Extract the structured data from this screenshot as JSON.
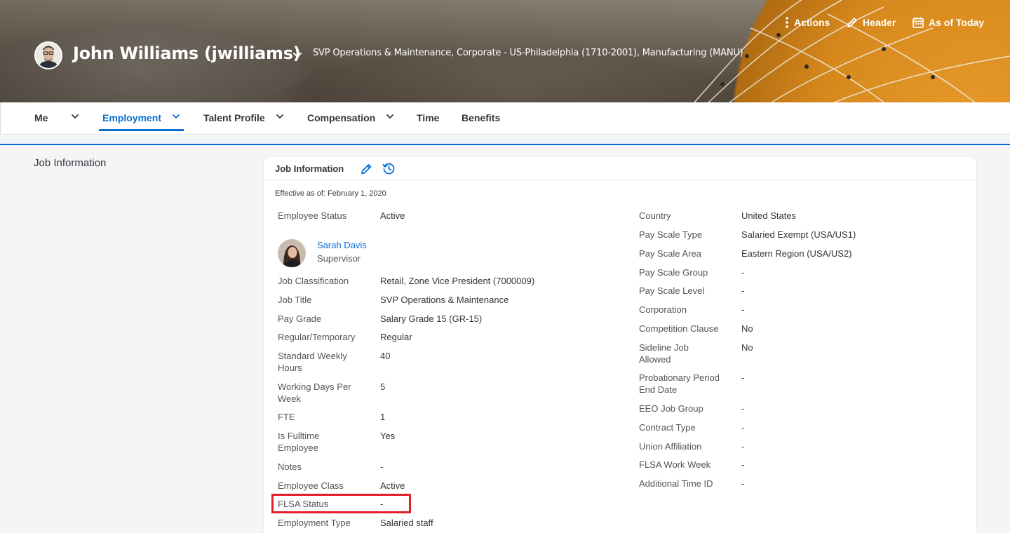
{
  "header": {
    "name": "John Williams (jwilliams)",
    "subtitle": "SVP Operations & Maintenance, Corporate - US-Philadelphia (1710-2001), Manufacturing (MANU)",
    "actions_label": "Actions",
    "header_label": "Header",
    "as_of_label": "As of Today"
  },
  "tabs": [
    {
      "label": "Me"
    },
    {
      "label": "Employment"
    },
    {
      "label": "Talent Profile"
    },
    {
      "label": "Compensation"
    },
    {
      "label": "Time"
    },
    {
      "label": "Benefits"
    }
  ],
  "sidebar": {
    "item": "Job Information"
  },
  "card": {
    "title": "Job Information",
    "effective": "Effective as of: February 1, 2020",
    "supervisor": {
      "name": "Sarah Davis",
      "role": "Supervisor"
    },
    "left_fields": [
      {
        "label": "Employee Status",
        "value": "Active"
      },
      {
        "label": "Job Classification",
        "value": "Retail, Zone Vice President (7000009)"
      },
      {
        "label": "Job Title",
        "value": "SVP Operations & Maintenance"
      },
      {
        "label": "Pay Grade",
        "value": "Salary Grade 15 (GR-15)"
      },
      {
        "label": "Regular/Temporary",
        "value": "Regular"
      },
      {
        "label": "Standard Weekly Hours",
        "value": "40"
      },
      {
        "label": "Working Days Per Week",
        "value": "5"
      },
      {
        "label": "FTE",
        "value": "1"
      },
      {
        "label": "Is Fulltime Employee",
        "value": "Yes"
      },
      {
        "label": "Notes",
        "value": "-"
      },
      {
        "label": "Employee Class",
        "value": "Active"
      },
      {
        "label": "FLSA Status",
        "value": "-"
      },
      {
        "label": "Employment Type",
        "value": "Salaried staff"
      }
    ],
    "right_fields": [
      {
        "label": "Country",
        "value": "United States"
      },
      {
        "label": "Pay Scale Type",
        "value": "Salaried Exempt (USA/US1)"
      },
      {
        "label": "Pay Scale Area",
        "value": "Eastern Region (USA/US2)"
      },
      {
        "label": "Pay Scale Group",
        "value": "-"
      },
      {
        "label": "Pay Scale Level",
        "value": "-"
      },
      {
        "label": "Corporation",
        "value": "-"
      },
      {
        "label": "Competition Clause",
        "value": "No"
      },
      {
        "label": "Sideline Job Allowed",
        "value": "No"
      },
      {
        "label": "Probationary Period End Date",
        "value": "-"
      },
      {
        "label": "EEO Job Group",
        "value": "-"
      },
      {
        "label": "Contract Type",
        "value": "-"
      },
      {
        "label": "Union Affiliation",
        "value": "-"
      },
      {
        "label": "FLSA Work Week",
        "value": "-"
      },
      {
        "label": "Additional Time ID",
        "value": "-"
      }
    ]
  },
  "colors": {
    "accent": "#0a6ed1",
    "highlight": "#e0202a"
  }
}
